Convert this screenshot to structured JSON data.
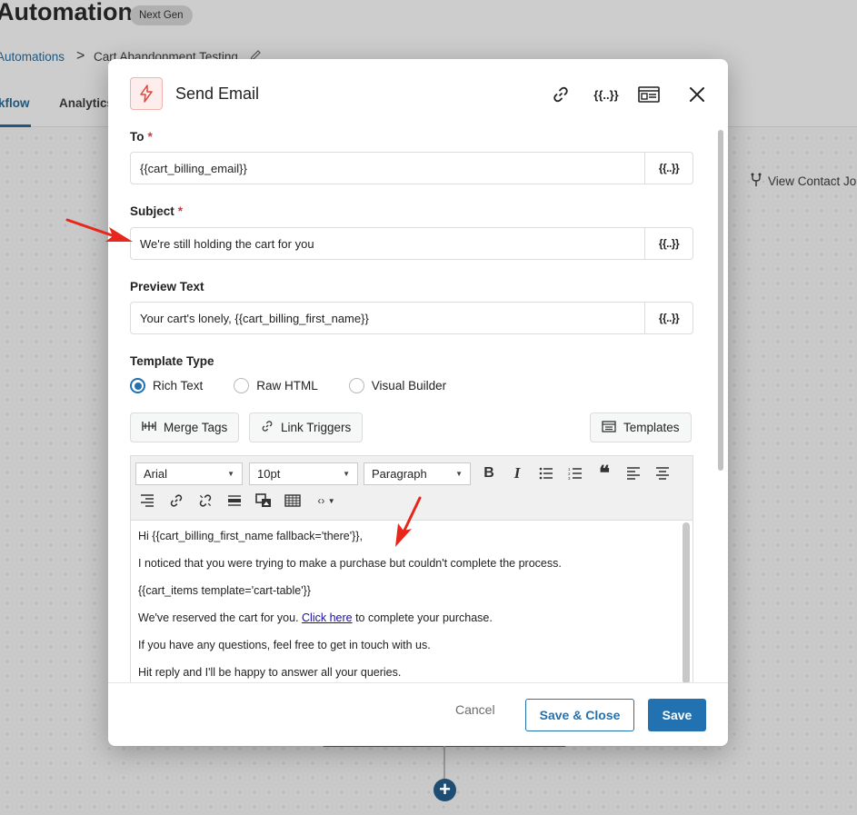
{
  "background": {
    "page_title": "Automations",
    "badge": "Next Gen",
    "breadcrumb_root": "Automations",
    "breadcrumb_separator": ">",
    "breadcrumb_current": "Cart Abandonment Testing",
    "tab_workflow": "kflow",
    "tab_analytics": "Analytics",
    "view_contact_journey": "View Contact Jo"
  },
  "modal": {
    "title": "Send Email",
    "header_icons": [
      "link-icon",
      "merge-tag-icon",
      "template-icon",
      "close-icon"
    ],
    "to": {
      "label": "To",
      "required": "*",
      "value": "{{cart_billing_email}}"
    },
    "subject": {
      "label": "Subject",
      "required": "*",
      "value": "We're still holding the cart for you"
    },
    "preview": {
      "label": "Preview Text",
      "value": "Your cart's lonely, {{cart_billing_first_name}}"
    },
    "var_button": "{{..}}",
    "template_type": {
      "label": "Template Type",
      "options": [
        "Rich Text",
        "Raw HTML",
        "Visual Builder"
      ],
      "selected": "Rich Text"
    },
    "buttons": {
      "merge_tags": "Merge Tags",
      "link_triggers": "Link Triggers",
      "templates": "Templates"
    },
    "editor": {
      "font_family": "Arial",
      "font_size": "10pt",
      "block_format": "Paragraph",
      "body": {
        "line1": "Hi {{cart_billing_first_name fallback='there'}},",
        "line2": "I noticed that you were trying to make a purchase but couldn't complete the process.",
        "line3": "{{cart_items template='cart-table'}}",
        "line4_pre": "We've reserved the cart for you. ",
        "line4_link": "Click here",
        "line4_post": " to complete your purchase.",
        "line5": "If you have any questions, feel free to get in touch with us.",
        "line6": "Hit reply and I'll be happy to answer all your queries."
      }
    },
    "footer": {
      "cancel": "Cancel",
      "save_close": "Save & Close",
      "save": "Save"
    }
  },
  "colors": {
    "primary": "#2271b1",
    "required": "#d63638",
    "annotation_arrow": "#e8261c",
    "action_icon": "#e2453b"
  }
}
